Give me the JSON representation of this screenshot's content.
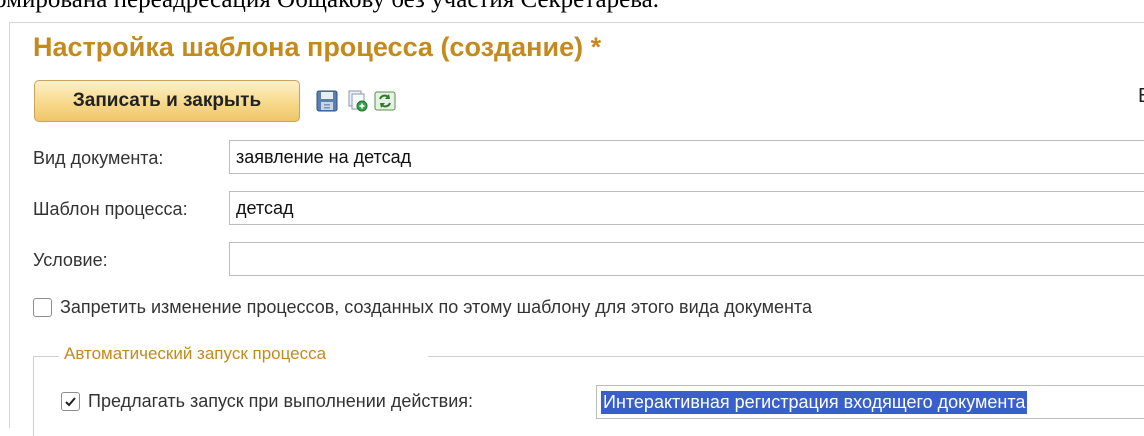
{
  "document_text": "рмирована переадресация Общакову без участия Секретарева.",
  "window": {
    "title": "Настройка шаблона процесса (создание) *"
  },
  "toolbar": {
    "save_close_label": "Записать и закрыть",
    "icons": [
      "save-icon",
      "copy-add-icon",
      "refresh-icon"
    ],
    "right_truncated_label": "В"
  },
  "fields": {
    "document_type": {
      "label": "Вид документа:",
      "value": "заявление на детсад"
    },
    "process_template": {
      "label": "Шаблон процесса:",
      "value": "детсад"
    },
    "condition": {
      "label": "Условие:",
      "value": ""
    }
  },
  "forbid_change": {
    "label": "Запретить изменение процессов, созданных по этому шаблону для этого вида документа",
    "checked": false
  },
  "auto_start": {
    "group_title": "Автоматический запуск процесса",
    "offer_label": "Предлагать запуск при выполнении действия:",
    "offer_checked": true,
    "action_value": "Интерактивная регистрация входящего документа"
  },
  "colors": {
    "title": "#c48a1c",
    "button_gradient_top": "#fdf1c9",
    "button_gradient_bottom": "#efc66a",
    "selection": "#3a5fcd"
  }
}
